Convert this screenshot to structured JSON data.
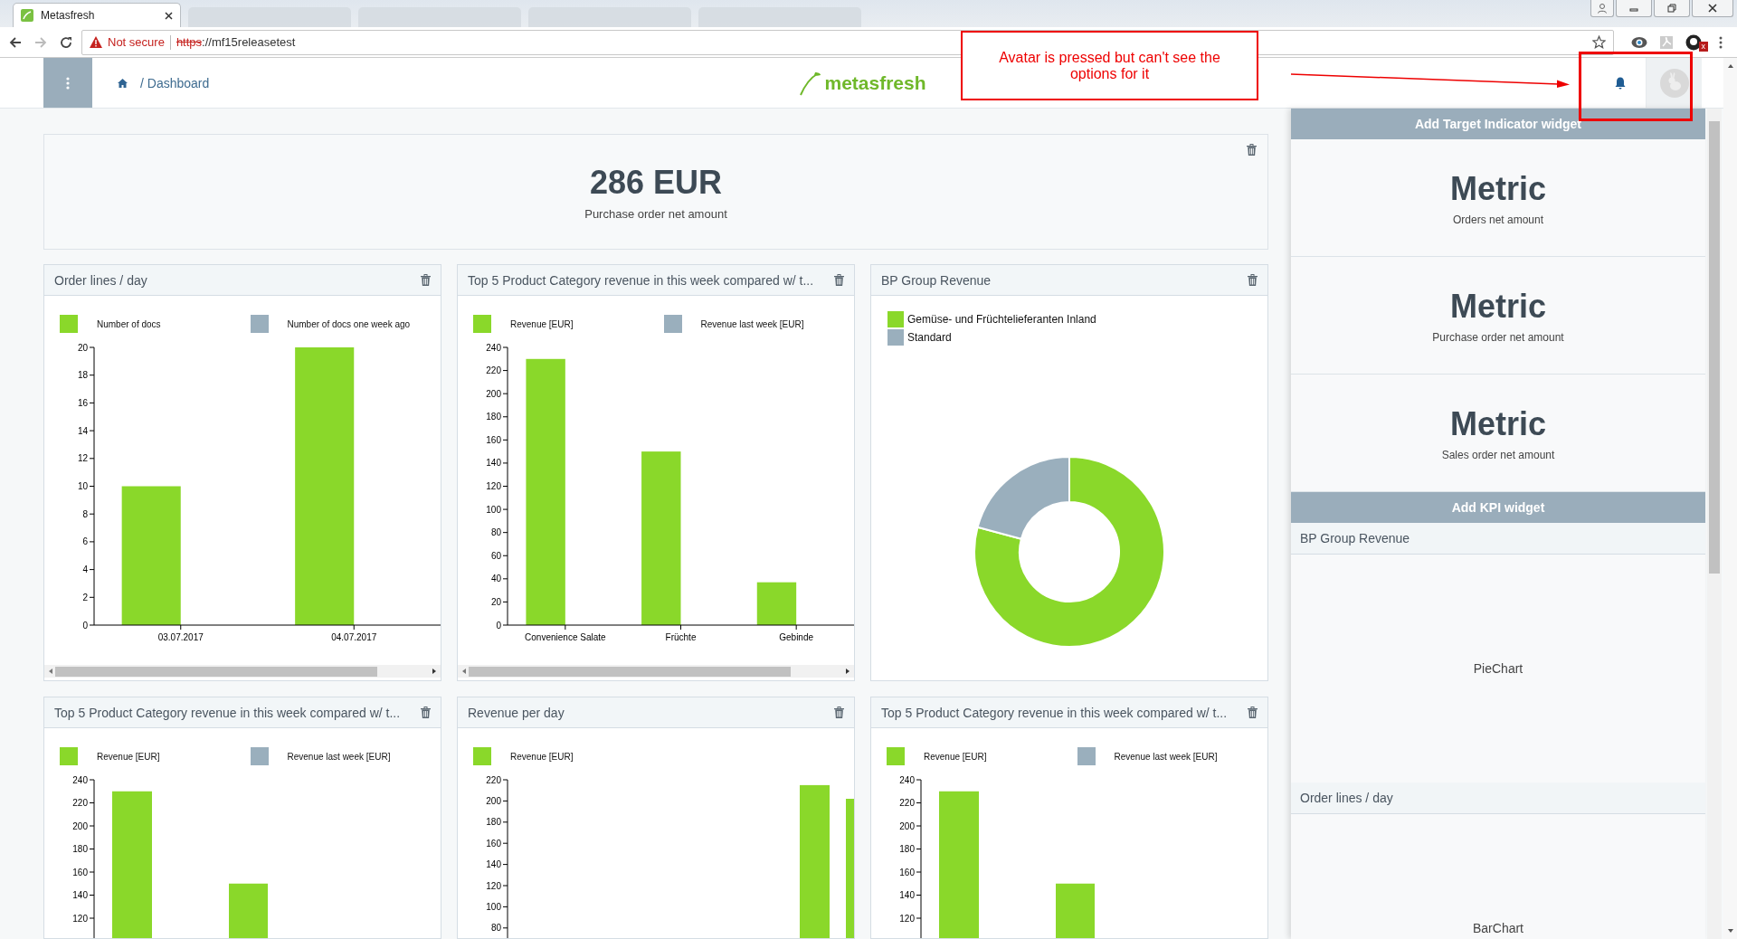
{
  "browser": {
    "tab_title": "Metasfresh",
    "security": "Not secure",
    "url_scheme": "https",
    "url_rest": "://mf15releasetest",
    "extension_badge": "x"
  },
  "header": {
    "breadcrumb": "/ Dashboard",
    "logo": "metasfresh",
    "avatar_pressed": true
  },
  "annotation": {
    "note": "Avatar is pressed but can't see the options for it"
  },
  "kpi": {
    "value": "286 EUR",
    "caption": "Purchase order net amount"
  },
  "widgets": [
    {
      "kind": "bar",
      "title": "Order lines / day",
      "chart_data": {
        "type": "bar",
        "categories": [
          "03.07.2017",
          "04.07.2017"
        ],
        "series": [
          {
            "name": "Number of docs",
            "color": "#8ad82a",
            "values": [
              10,
              20
            ]
          },
          {
            "name": "Number of docs one week ago",
            "color": "#9aafbd",
            "values": [
              null,
              null
            ]
          }
        ],
        "ylim": [
          0,
          20
        ],
        "yticks": [
          0,
          2,
          4,
          6,
          8,
          10,
          12,
          14,
          16,
          18,
          20
        ]
      }
    },
    {
      "kind": "bar",
      "title": "Top 5 Product Category revenue in this week compared w/ t...",
      "chart_data": {
        "type": "bar",
        "categories": [
          "Convenience Salate",
          "Früchte",
          "Gebinde"
        ],
        "series": [
          {
            "name": "Revenue [EUR]",
            "color": "#8ad82a",
            "values": [
              230,
              150,
              37
            ]
          },
          {
            "name": "Revenue last week [EUR]",
            "color": "#9aafbd",
            "values": [
              null,
              null,
              null
            ]
          }
        ],
        "ylim": [
          0,
          240
        ],
        "yticks": [
          0,
          20,
          40,
          60,
          80,
          100,
          120,
          140,
          160,
          180,
          200,
          220,
          240
        ]
      }
    },
    {
      "kind": "donut",
      "title": "BP Group Revenue",
      "legend": [
        {
          "label": "Gemüse- und Früchtelieferanten Inland",
          "color": "#8ad82a"
        },
        {
          "label": "Standard",
          "color": "#9aafbd"
        }
      ]
    },
    {
      "kind": "bar_cut",
      "title": "Top 5 Product Category revenue in this week compared w/ t...",
      "legend": [
        {
          "label": "Revenue [EUR]",
          "color": "#8ad82a"
        },
        {
          "label": "Revenue last week [EUR]",
          "color": "#9aafbd"
        }
      ],
      "y_ticks": [
        "240",
        "220",
        "200",
        "180",
        "160",
        "140",
        "120"
      ]
    },
    {
      "kind": "bar_cut",
      "title": "Revenue per day",
      "legend": [
        {
          "label": "Revenue [EUR]",
          "color": "#8ad82a"
        }
      ],
      "y_ticks": [
        "220",
        "200",
        "180",
        "160",
        "140",
        "120",
        "100",
        "80"
      ]
    },
    {
      "kind": "bar_cut",
      "title": "Top 5 Product Category revenue in this week compared w/ t...",
      "legend": [
        {
          "label": "Revenue [EUR]",
          "color": "#8ad82a"
        },
        {
          "label": "Revenue last week [EUR]",
          "color": "#9aafbd"
        }
      ],
      "y_ticks": [
        "240",
        "220",
        "200",
        "180",
        "160",
        "140",
        "120"
      ]
    }
  ],
  "sidebar": {
    "target_header": "Add Target Indicator widget",
    "metrics": [
      {
        "value": "Metric",
        "caption": "Orders net amount"
      },
      {
        "value": "Metric",
        "caption": "Purchase order net amount"
      },
      {
        "value": "Metric",
        "caption": "Sales order net amount"
      }
    ],
    "kpi_header": "Add KPI widget",
    "kpis": [
      {
        "title": "BP Group Revenue",
        "chart_type": "PieChart"
      },
      {
        "title": "Order lines / day",
        "chart_type": "BarChart"
      }
    ]
  }
}
